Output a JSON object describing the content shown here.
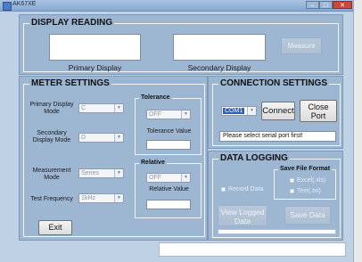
{
  "window": {
    "title": "AK67XE",
    "minimize_glyph": "‒",
    "maximize_glyph": "□",
    "close_glyph": "✕"
  },
  "display_reading": {
    "title": "DISPLAY READING",
    "primary_label": "Primary Display",
    "secondary_label": "Secondary Display",
    "measure_button": "Measure"
  },
  "meter_settings": {
    "title": "METER SETTINGS",
    "primary_mode_label": "Primary Display Mode",
    "primary_mode_value": "C",
    "secondary_mode_label": "Secondary Display Mode",
    "secondary_mode_value": "D",
    "measurement_mode_label": "Measurement Mode",
    "measurement_mode_value": "Series",
    "test_frequency_label": "Test Frequency",
    "test_frequency_value": "1kHz",
    "tolerance": {
      "title": "Tolerance",
      "value": "OFF",
      "value_label": "Tolerance Value"
    },
    "relative": {
      "title": "Relative",
      "value": "OFF",
      "value_label": "Relative Value"
    },
    "exit_button": "Exit"
  },
  "connection_settings": {
    "title": "CONNECTION SETTINGS",
    "port_value": "COM1",
    "connect_button": "Connect",
    "close_port_button": "Close Port",
    "status_message": "Please select serial port first!"
  },
  "data_logging": {
    "title": "DATA LOGGING",
    "record_data_label": "Record Data",
    "save_format_title": "Save File Format",
    "excel_label": "Excel(.xls)",
    "text_label": "Text(.txt)",
    "view_logged_button": "View Logged Data",
    "save_data_button": "Save Data"
  },
  "icons": {
    "dropdown": "chevron-down-icon",
    "app": "app-icon"
  }
}
